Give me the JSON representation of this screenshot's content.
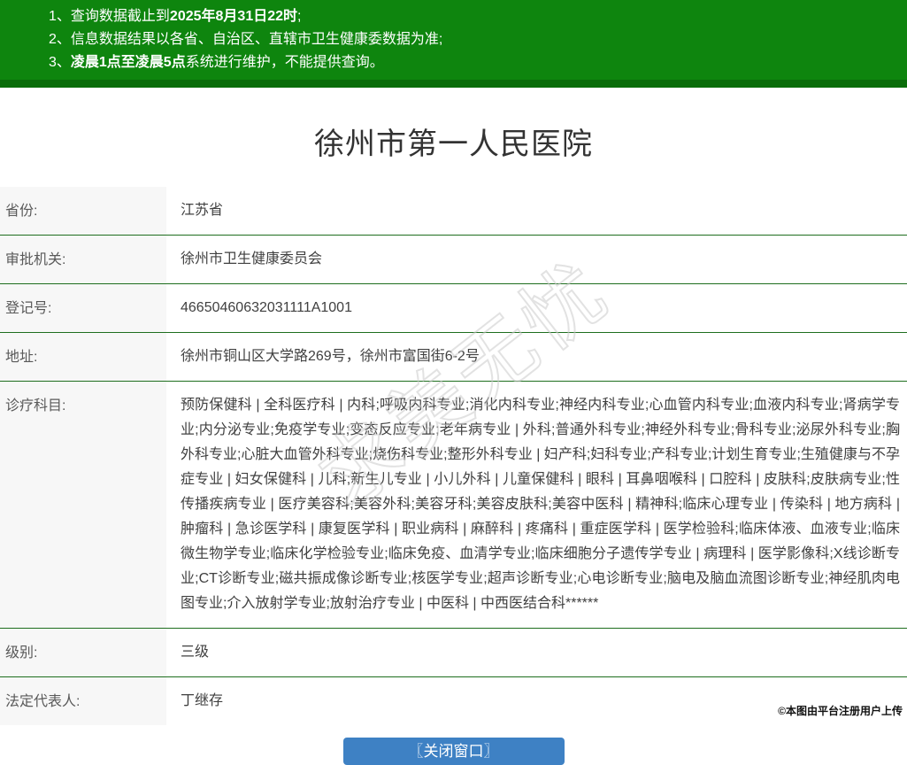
{
  "notices": {
    "items": [
      {
        "num": "1、",
        "pre": "查询数据截止到",
        "bold": "2025年8月31日22时",
        "post": ";"
      },
      {
        "num": "2、",
        "pre": "信息数据结果以各省、自治区、直辖市卫生健康委数据为准;",
        "bold": "",
        "post": ""
      },
      {
        "num": "3、",
        "pre": "",
        "bold": "凌晨1点至凌晨5点",
        "post": "系统进行维护，不能提供查询。"
      }
    ]
  },
  "title": "徐州市第一人民医院",
  "table": {
    "rows": [
      {
        "label": "省份:",
        "value": "江苏省"
      },
      {
        "label": "审批机关:",
        "value": "徐州市卫生健康委员会"
      },
      {
        "label": "登记号:",
        "value": "46650460632031111A1001"
      },
      {
        "label": "地址:",
        "value": "徐州市铜山区大学路269号，徐州市富国街6-2号"
      },
      {
        "label": "诊疗科目:",
        "value": "预防保健科 | 全科医疗科 | 内科;呼吸内科专业;消化内科专业;神经内科专业;心血管内科专业;血液内科专业;肾病学专业;内分泌专业;免疫学专业;变态反应专业;老年病专业 | 外科;普通外科专业;神经外科专业;骨科专业;泌尿外科专业;胸外科专业;心脏大血管外科专业;烧伤科专业;整形外科专业 | 妇产科;妇科专业;产科专业;计划生育专业;生殖健康与不孕症专业 | 妇女保健科 | 儿科;新生儿专业 | 小儿外科 | 儿童保健科 | 眼科 | 耳鼻咽喉科 | 口腔科 | 皮肤科;皮肤病专业;性传播疾病专业 | 医疗美容科;美容外科;美容牙科;美容皮肤科;美容中医科 | 精神科;临床心理专业 | 传染科 | 地方病科 | 肿瘤科 | 急诊医学科 | 康复医学科 | 职业病科 | 麻醉科 | 疼痛科 | 重症医学科 | 医学检验科;临床体液、血液专业;临床微生物学专业;临床化学检验专业;临床免疫、血清学专业;临床细胞分子遗传学专业 | 病理科 | 医学影像科;X线诊断专业;CT诊断专业;磁共振成像诊断专业;核医学专业;超声诊断专业;心电诊断专业;脑电及脑血流图诊断专业;神经肌肉电图专业;介入放射学专业;放射治疗专业 | 中医科 | 中西医结合科******"
      },
      {
        "label": "级别:",
        "value": "三级"
      },
      {
        "label": "法定代表人:",
        "value": "丁继存"
      }
    ]
  },
  "watermark": "求美无忧",
  "close_button": "〖关闭窗口〗",
  "footer": "©本图由平台注册用户上传",
  "colors": {
    "banner_green": "#0e850e",
    "banner_strip_green": "#0a6d0a",
    "divider_green": "#1e6e1e",
    "button_blue": "#3e81c4",
    "label_column_bg": "#f7f7f7"
  }
}
